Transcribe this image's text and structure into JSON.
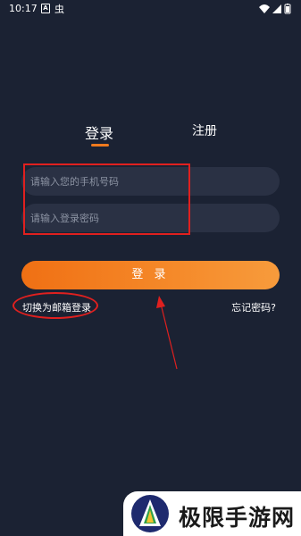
{
  "status_bar": {
    "time": "10:17",
    "notification_letter": "A",
    "app_glyph": "虫"
  },
  "tabs": {
    "login_label": "登录",
    "register_label": "注册"
  },
  "form": {
    "phone_placeholder": "请输入您的手机号码",
    "password_placeholder": "请输入登录密码",
    "login_button": "登 录",
    "switch_email_label": "切换为邮箱登录",
    "forgot_password_label": "忘记密码?"
  },
  "colors": {
    "background": "#1b2233",
    "accent_orange": "#f07a1e",
    "annotation_red": "#e0201f"
  },
  "watermark": {
    "text": "极限手游网"
  }
}
